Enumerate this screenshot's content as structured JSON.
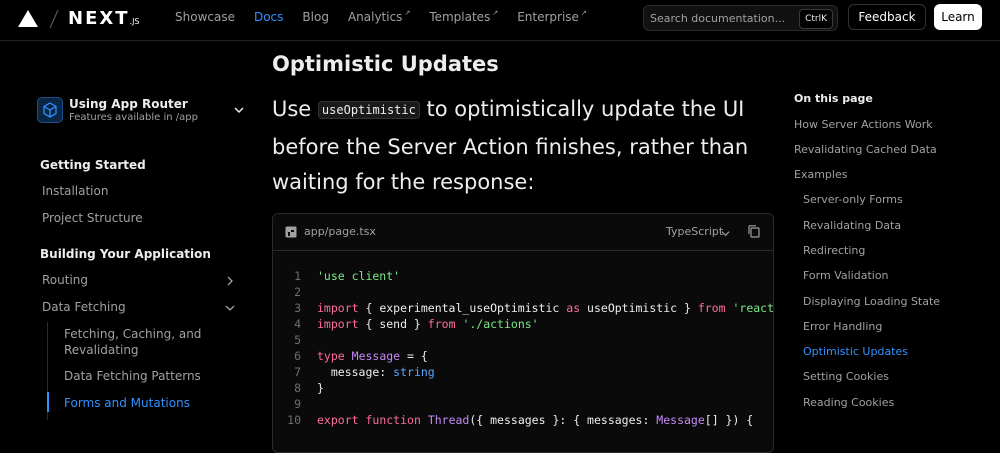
{
  "header": {
    "logo": "NEXT",
    "logo_suffix": ".JS",
    "nav": [
      {
        "label": "Showcase",
        "external": false,
        "active": false
      },
      {
        "label": "Docs",
        "external": false,
        "active": true
      },
      {
        "label": "Blog",
        "external": false,
        "active": false
      },
      {
        "label": "Analytics",
        "external": true,
        "active": false
      },
      {
        "label": "Templates",
        "external": true,
        "active": false
      },
      {
        "label": "Enterprise",
        "external": true,
        "active": false
      }
    ],
    "search_placeholder": "Search documentation...",
    "search_shortcut": "CtrlK",
    "feedback_label": "Feedback",
    "learn_label": "Learn"
  },
  "sidebar": {
    "router_title": "Using App Router",
    "router_subtitle": "Features available in /app",
    "sections": [
      {
        "heading": "Getting Started",
        "items": [
          "Installation",
          "Project Structure"
        ]
      },
      {
        "heading": "Building Your Application",
        "items": [
          "Routing",
          "Data Fetching"
        ],
        "sub_items": [
          "Fetching, Caching, and Revalidating",
          "Data Fetching Patterns",
          "Forms and Mutations"
        ],
        "active_sub": "Forms and Mutations"
      }
    ]
  },
  "main": {
    "heading": "Optimistic Updates",
    "lead_before": "Use ",
    "lead_code": "useOptimistic",
    "lead_after": " to optimistically update the UI before the Server Action finishes, rather than waiting for the response:",
    "code": {
      "filename": "app/page.tsx",
      "language": "TypeScript",
      "line_numbers": [
        "1",
        "2",
        "3",
        "4",
        "5",
        "6",
        "7",
        "8",
        "9",
        "10"
      ],
      "lines": [
        "'use client'",
        "",
        "import { experimental_useOptimistic as useOptimistic } from 'react'",
        "import { send } from './actions'",
        "",
        "type Message = {",
        "  message: string",
        "}",
        "",
        "export function Thread({ messages }: { messages: Message[] }) {"
      ]
    }
  },
  "toc": {
    "heading": "On this page",
    "items": [
      {
        "label": "How Server Actions Work",
        "level": 1,
        "active": false
      },
      {
        "label": "Revalidating Cached Data",
        "level": 1,
        "active": false
      },
      {
        "label": "Examples",
        "level": 1,
        "active": false
      },
      {
        "label": "Server-only Forms",
        "level": 2,
        "active": false
      },
      {
        "label": "Revalidating Data",
        "level": 2,
        "active": false
      },
      {
        "label": "Redirecting",
        "level": 2,
        "active": false
      },
      {
        "label": "Form Validation",
        "level": 2,
        "active": false
      },
      {
        "label": "Displaying Loading State",
        "level": 2,
        "active": false
      },
      {
        "label": "Error Handling",
        "level": 2,
        "active": false
      },
      {
        "label": "Optimistic Updates",
        "level": 2,
        "active": true
      },
      {
        "label": "Setting Cookies",
        "level": 2,
        "active": false
      },
      {
        "label": "Reading Cookies",
        "level": 2,
        "active": false
      }
    ]
  },
  "colors": {
    "background": "#000000",
    "accent": "#3291ff",
    "muted_text": "#a1a1a1",
    "string": "#7ee787",
    "keyword": "#ff6b9c"
  },
  "icons": [
    "nextjs-triangle-icon",
    "cube-icon",
    "chevron-down-icon",
    "chevron-right-icon",
    "file-icon",
    "copy-icon",
    "external-arrow-icon"
  ]
}
